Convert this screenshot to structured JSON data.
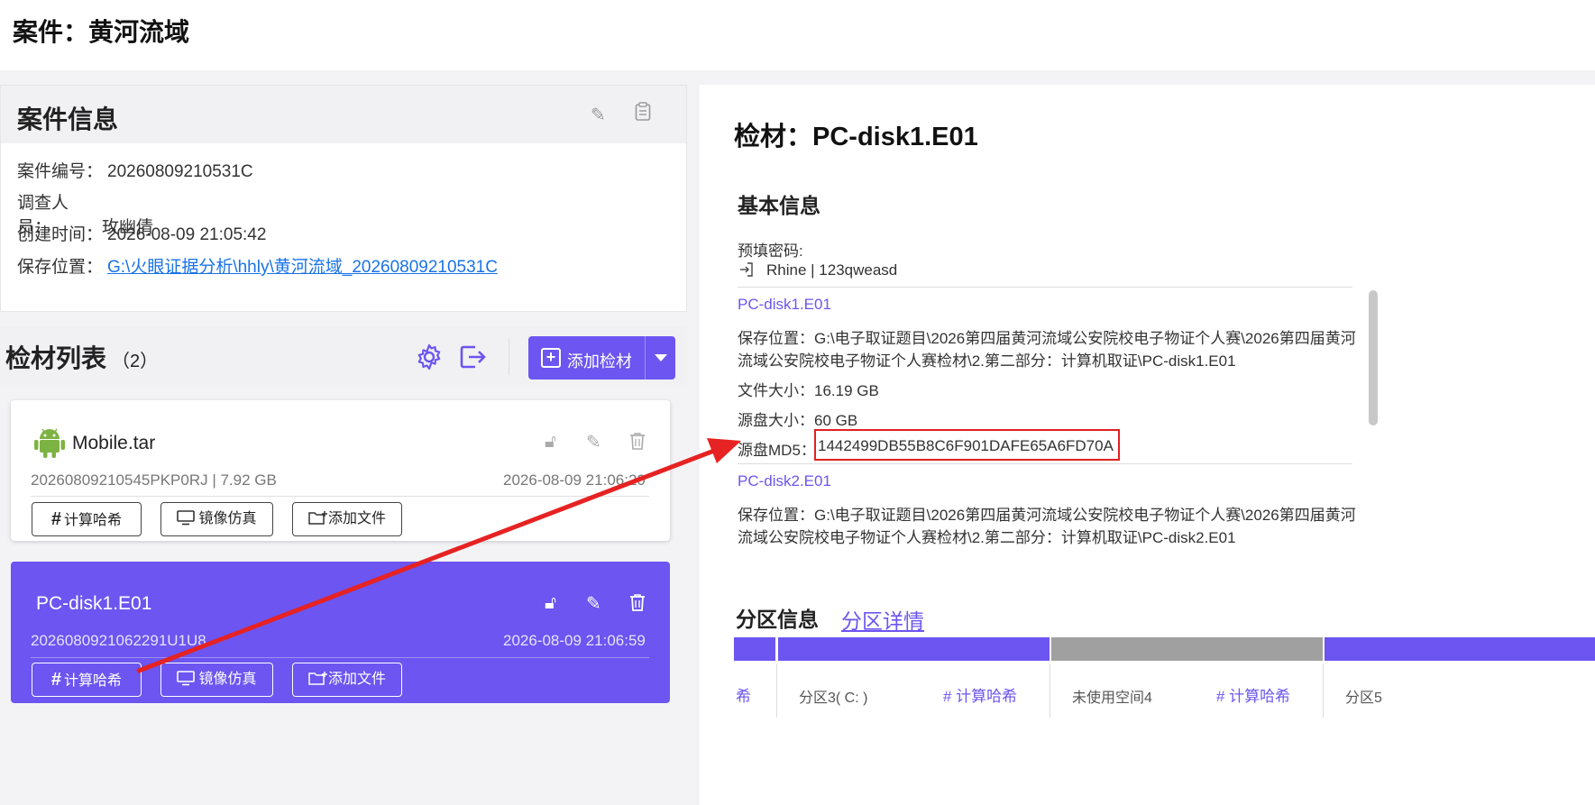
{
  "header": {
    "case_title": "案件：黄河流域"
  },
  "case_info": {
    "title": "案件信息",
    "rows": [
      {
        "label": "案件编号：",
        "value": "20260809210531C"
      },
      {
        "label": "调查人员：",
        "value": "玫幽倩"
      },
      {
        "label": "创建时间：",
        "value": "2026-08-09 21:05:42"
      },
      {
        "label": "保存位置：",
        "value": "G:\\火眼证据分析\\hhly\\黄河流域_20260809210531C"
      }
    ],
    "icons": [
      "edit-icon",
      "clipboard-icon"
    ]
  },
  "evidence_list": {
    "title": "检材列表",
    "count": "（2）",
    "add_label": "添加检材",
    "cards": [
      {
        "name": "Mobile.tar",
        "meta": "20260809210545PKP0RJ | 7.92 GB",
        "time": "2026-08-09 21:06:20",
        "icon": "android-icon",
        "selected": false
      },
      {
        "name": "PC-disk1.E01",
        "meta": "2026080921062291U1U8",
        "time": "2026-08-09 21:06:59",
        "selected": true
      }
    ],
    "buttons": {
      "hash": "计算哈希",
      "mirror": "镜像仿真",
      "add_file": "添加文件"
    }
  },
  "detail": {
    "title": "检材：PC-disk1.E01",
    "basic_title": "基本信息",
    "password_label": "预填密码:",
    "password_value": "Rhine | 123qweasd",
    "disks": [
      {
        "name": "PC-disk1.E01",
        "path_line1": "保存位置：G:\\电子取证题目\\2026第四届黄河流域公安院校电子物证个人赛\\2026第四届黄河",
        "path_line2": "流域公安院校电子物证个人赛检材\\2.第二部分：计算机取证\\PC-disk1.E01",
        "file_size": "文件大小：16.19 GB",
        "disk_size": "源盘大小：60 GB",
        "md5_label": "源盘MD5：",
        "md5_value": "1442499DB55B8C6F901DAFE65A6FD70A"
      },
      {
        "name": "PC-disk2.E01",
        "path_line1": "保存位置：G:\\电子取证题目\\2026第四届黄河流域公安院校电子物证个人赛\\2026第四届黄河",
        "path_line2": "流域公安院校电子物证个人赛检材\\2.第二部分：计算机取证\\PC-disk2.E01"
      }
    ],
    "partition_title": "分区信息",
    "partition_detail": "分区详情",
    "partitions": [
      {
        "name": "",
        "hash": "希"
      },
      {
        "name": "分区3( C: )",
        "hash": "# 计算哈希"
      },
      {
        "name": "未使用空间4",
        "hash": "# 计算哈希"
      },
      {
        "name": "分区5",
        "hash": ""
      }
    ]
  },
  "colors": {
    "accent": "#6c55f0",
    "highlight_box": "#e02020",
    "arrow": "#e62222"
  }
}
